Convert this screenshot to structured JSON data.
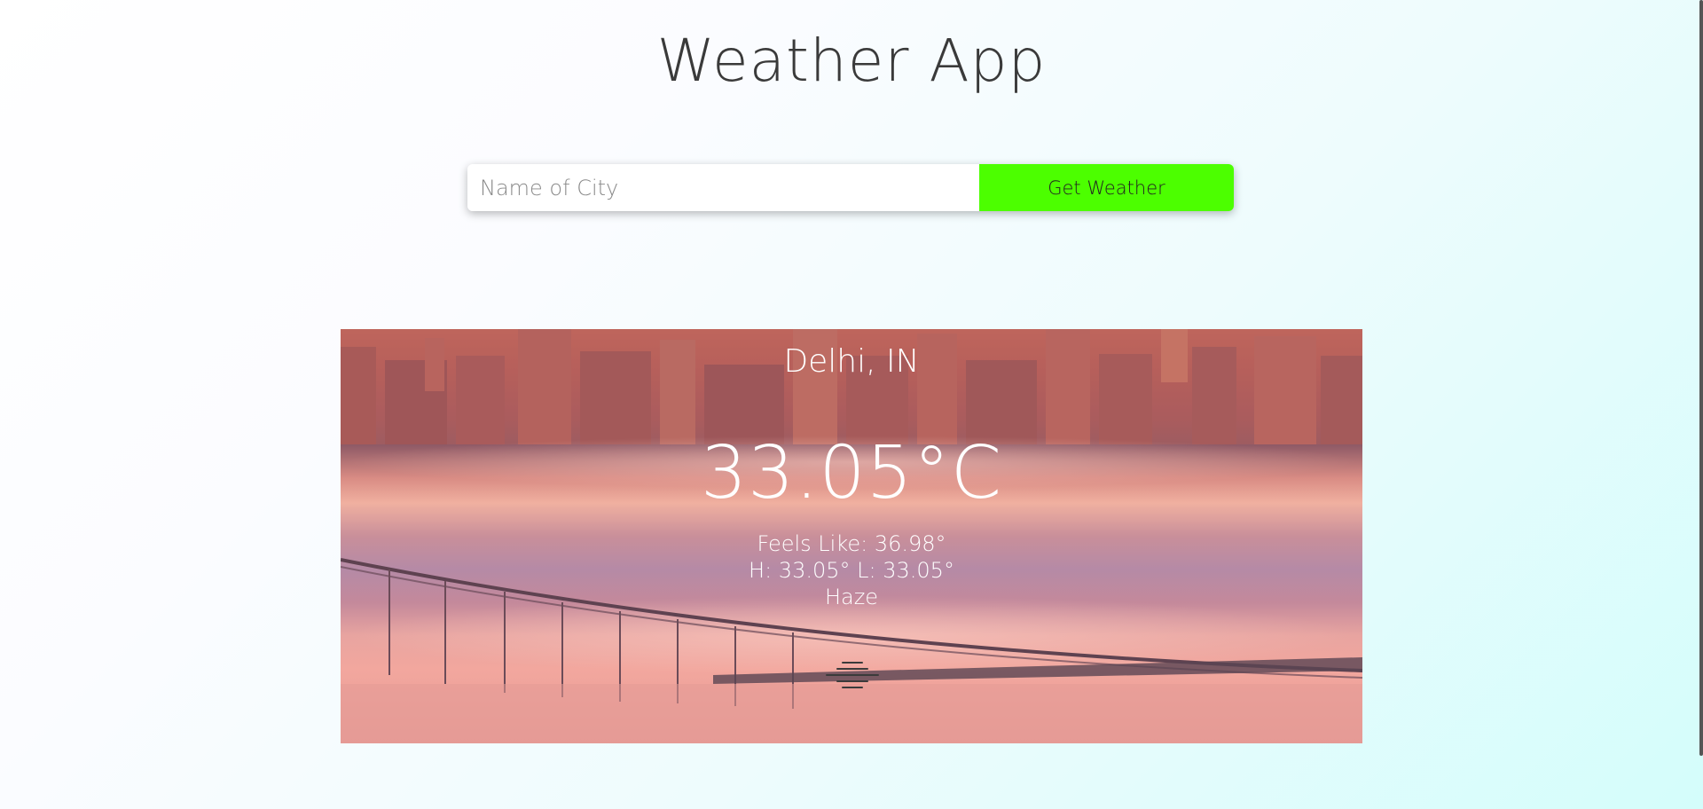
{
  "header": {
    "title": "Weather App"
  },
  "search": {
    "placeholder": "Name of City",
    "value": "",
    "button_label": "Get Weather",
    "button_color": "#4cff00"
  },
  "weather": {
    "city": "Delhi, IN",
    "temperature": "33.05°C",
    "feels_like": "Feels Like: 36.98°",
    "high_low": "H: 33.05° L: 33.05°",
    "description": "Haze",
    "icon": "haze-icon",
    "background": "foggy-bridge-sunset-photo"
  },
  "colors": {
    "background_start": "#ffffff",
    "background_end": "#d4fdfb",
    "title_text": "#3a3a3a",
    "card_text": "#ffffff"
  }
}
